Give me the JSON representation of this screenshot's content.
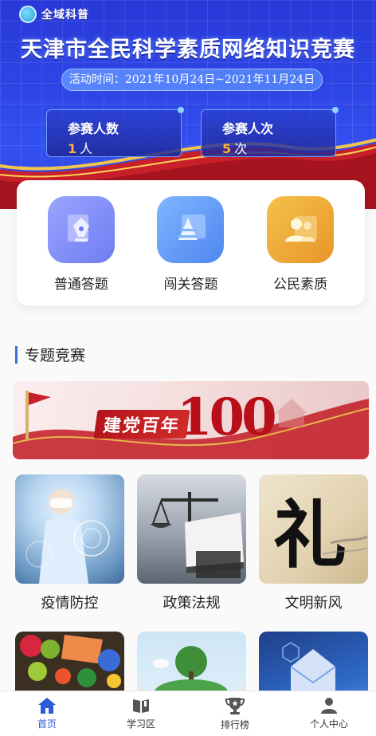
{
  "header": {
    "logo_text": "全域科普",
    "title": "天津市全民科学素质网络知识竞赛",
    "period": "活动时间：2021年10月24日~2021年11月24日"
  },
  "stats": [
    {
      "label": "参赛人数",
      "value": "1",
      "unit": "人"
    },
    {
      "label": "参赛人次",
      "value": "5",
      "unit": "次"
    }
  ],
  "features": [
    {
      "label": "普通答题",
      "icon": "pen-nib-icon"
    },
    {
      "label": "闯关答题",
      "icon": "pyramid-icon"
    },
    {
      "label": "公民素质",
      "icon": "people-icon"
    }
  ],
  "section": {
    "title": "专题竞赛"
  },
  "party_banner": {
    "slogan": "建党百年",
    "number": "100"
  },
  "categories": [
    {
      "label": "疫情防控"
    },
    {
      "label": "政策法规"
    },
    {
      "label": "文明新风"
    },
    {
      "label": ""
    },
    {
      "label": ""
    },
    {
      "label": ""
    }
  ],
  "tabbar": [
    {
      "label": "首页",
      "icon": "home-icon",
      "active": true
    },
    {
      "label": "学习区",
      "icon": "book-icon",
      "active": false
    },
    {
      "label": "排行榜",
      "icon": "trophy-icon",
      "active": false
    },
    {
      "label": "个人中心",
      "icon": "user-icon",
      "active": false
    }
  ],
  "colors": {
    "accent": "#2d5bd6",
    "banner_blue": "#2f46e6",
    "stat_orange": "#ffb23a",
    "party_red": "#b80f18"
  }
}
